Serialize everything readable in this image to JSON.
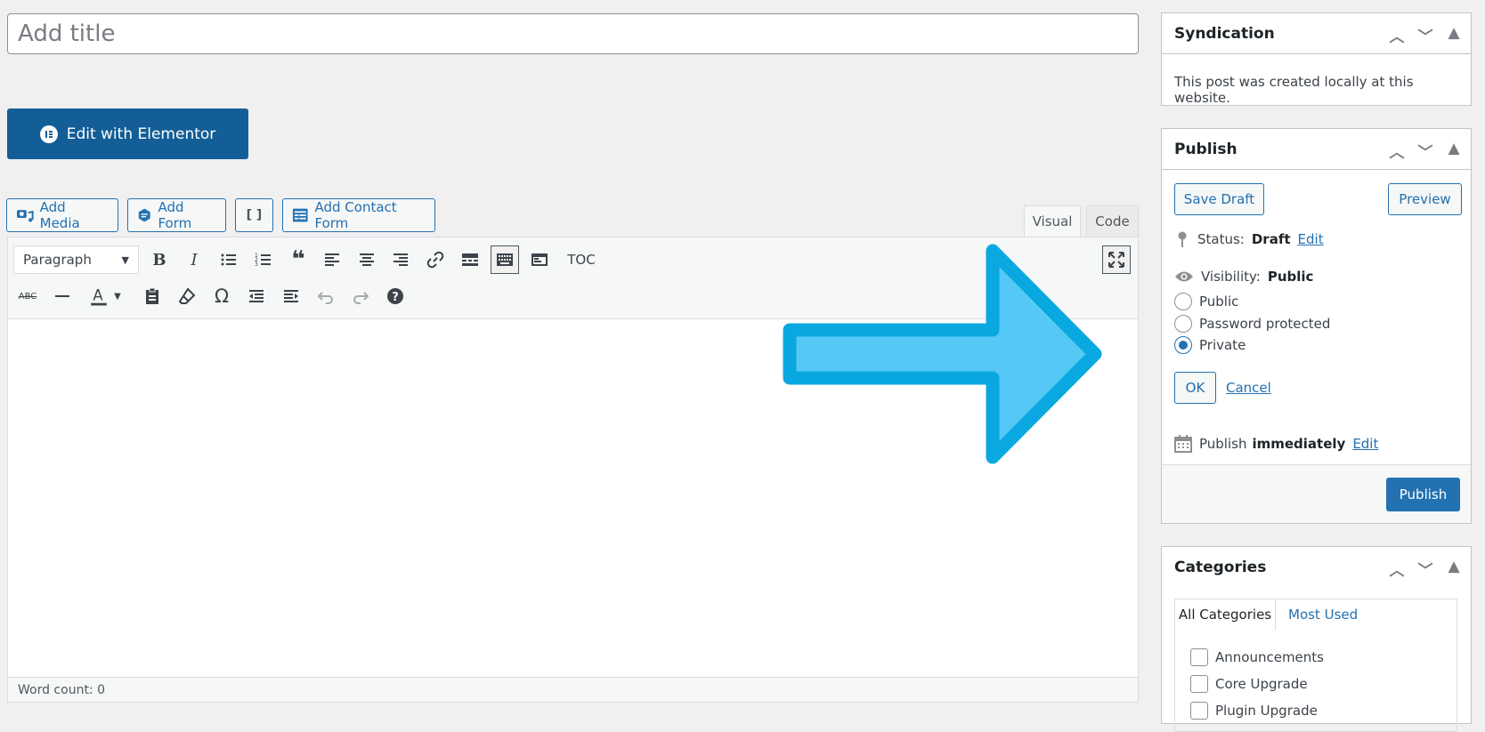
{
  "title": {
    "placeholder": "Add title"
  },
  "elementor": {
    "label": "Edit with Elementor"
  },
  "media_buttons": {
    "add_media": "Add Media",
    "add_form": "Add Form",
    "shortcode": "[ ]",
    "add_contact_form": "Add Contact Form"
  },
  "tabs": {
    "visual": "Visual",
    "code": "Code"
  },
  "toolbar": {
    "format": "Paragraph",
    "toc": "TOC"
  },
  "status_bar": {
    "word_count": "Word count: 0"
  },
  "syndication": {
    "title": "Syndication",
    "text": "This post was created locally at this website."
  },
  "publish": {
    "title": "Publish",
    "save_draft": "Save Draft",
    "preview": "Preview",
    "status_label": "Status:",
    "status_value": "Draft",
    "edit": "Edit",
    "visibility_label": "Visibility:",
    "visibility_value": "Public",
    "options": [
      "Public",
      "Password protected",
      "Private"
    ],
    "selected": "Private",
    "ok": "OK",
    "cancel": "Cancel",
    "publish_label": "Publish",
    "publish_when": "immediately",
    "publish_edit": "Edit",
    "publish_button": "Publish"
  },
  "categories": {
    "title": "Categories",
    "tab_all": "All Categories",
    "tab_used": "Most Used",
    "items": [
      "Announcements",
      "Core Upgrade",
      "Plugin Upgrade"
    ]
  },
  "colors": {
    "accent": "#2271b1",
    "elementor": "#135e96",
    "arrow_fill": "#56c8f5",
    "arrow_stroke": "#0aa8e0"
  }
}
